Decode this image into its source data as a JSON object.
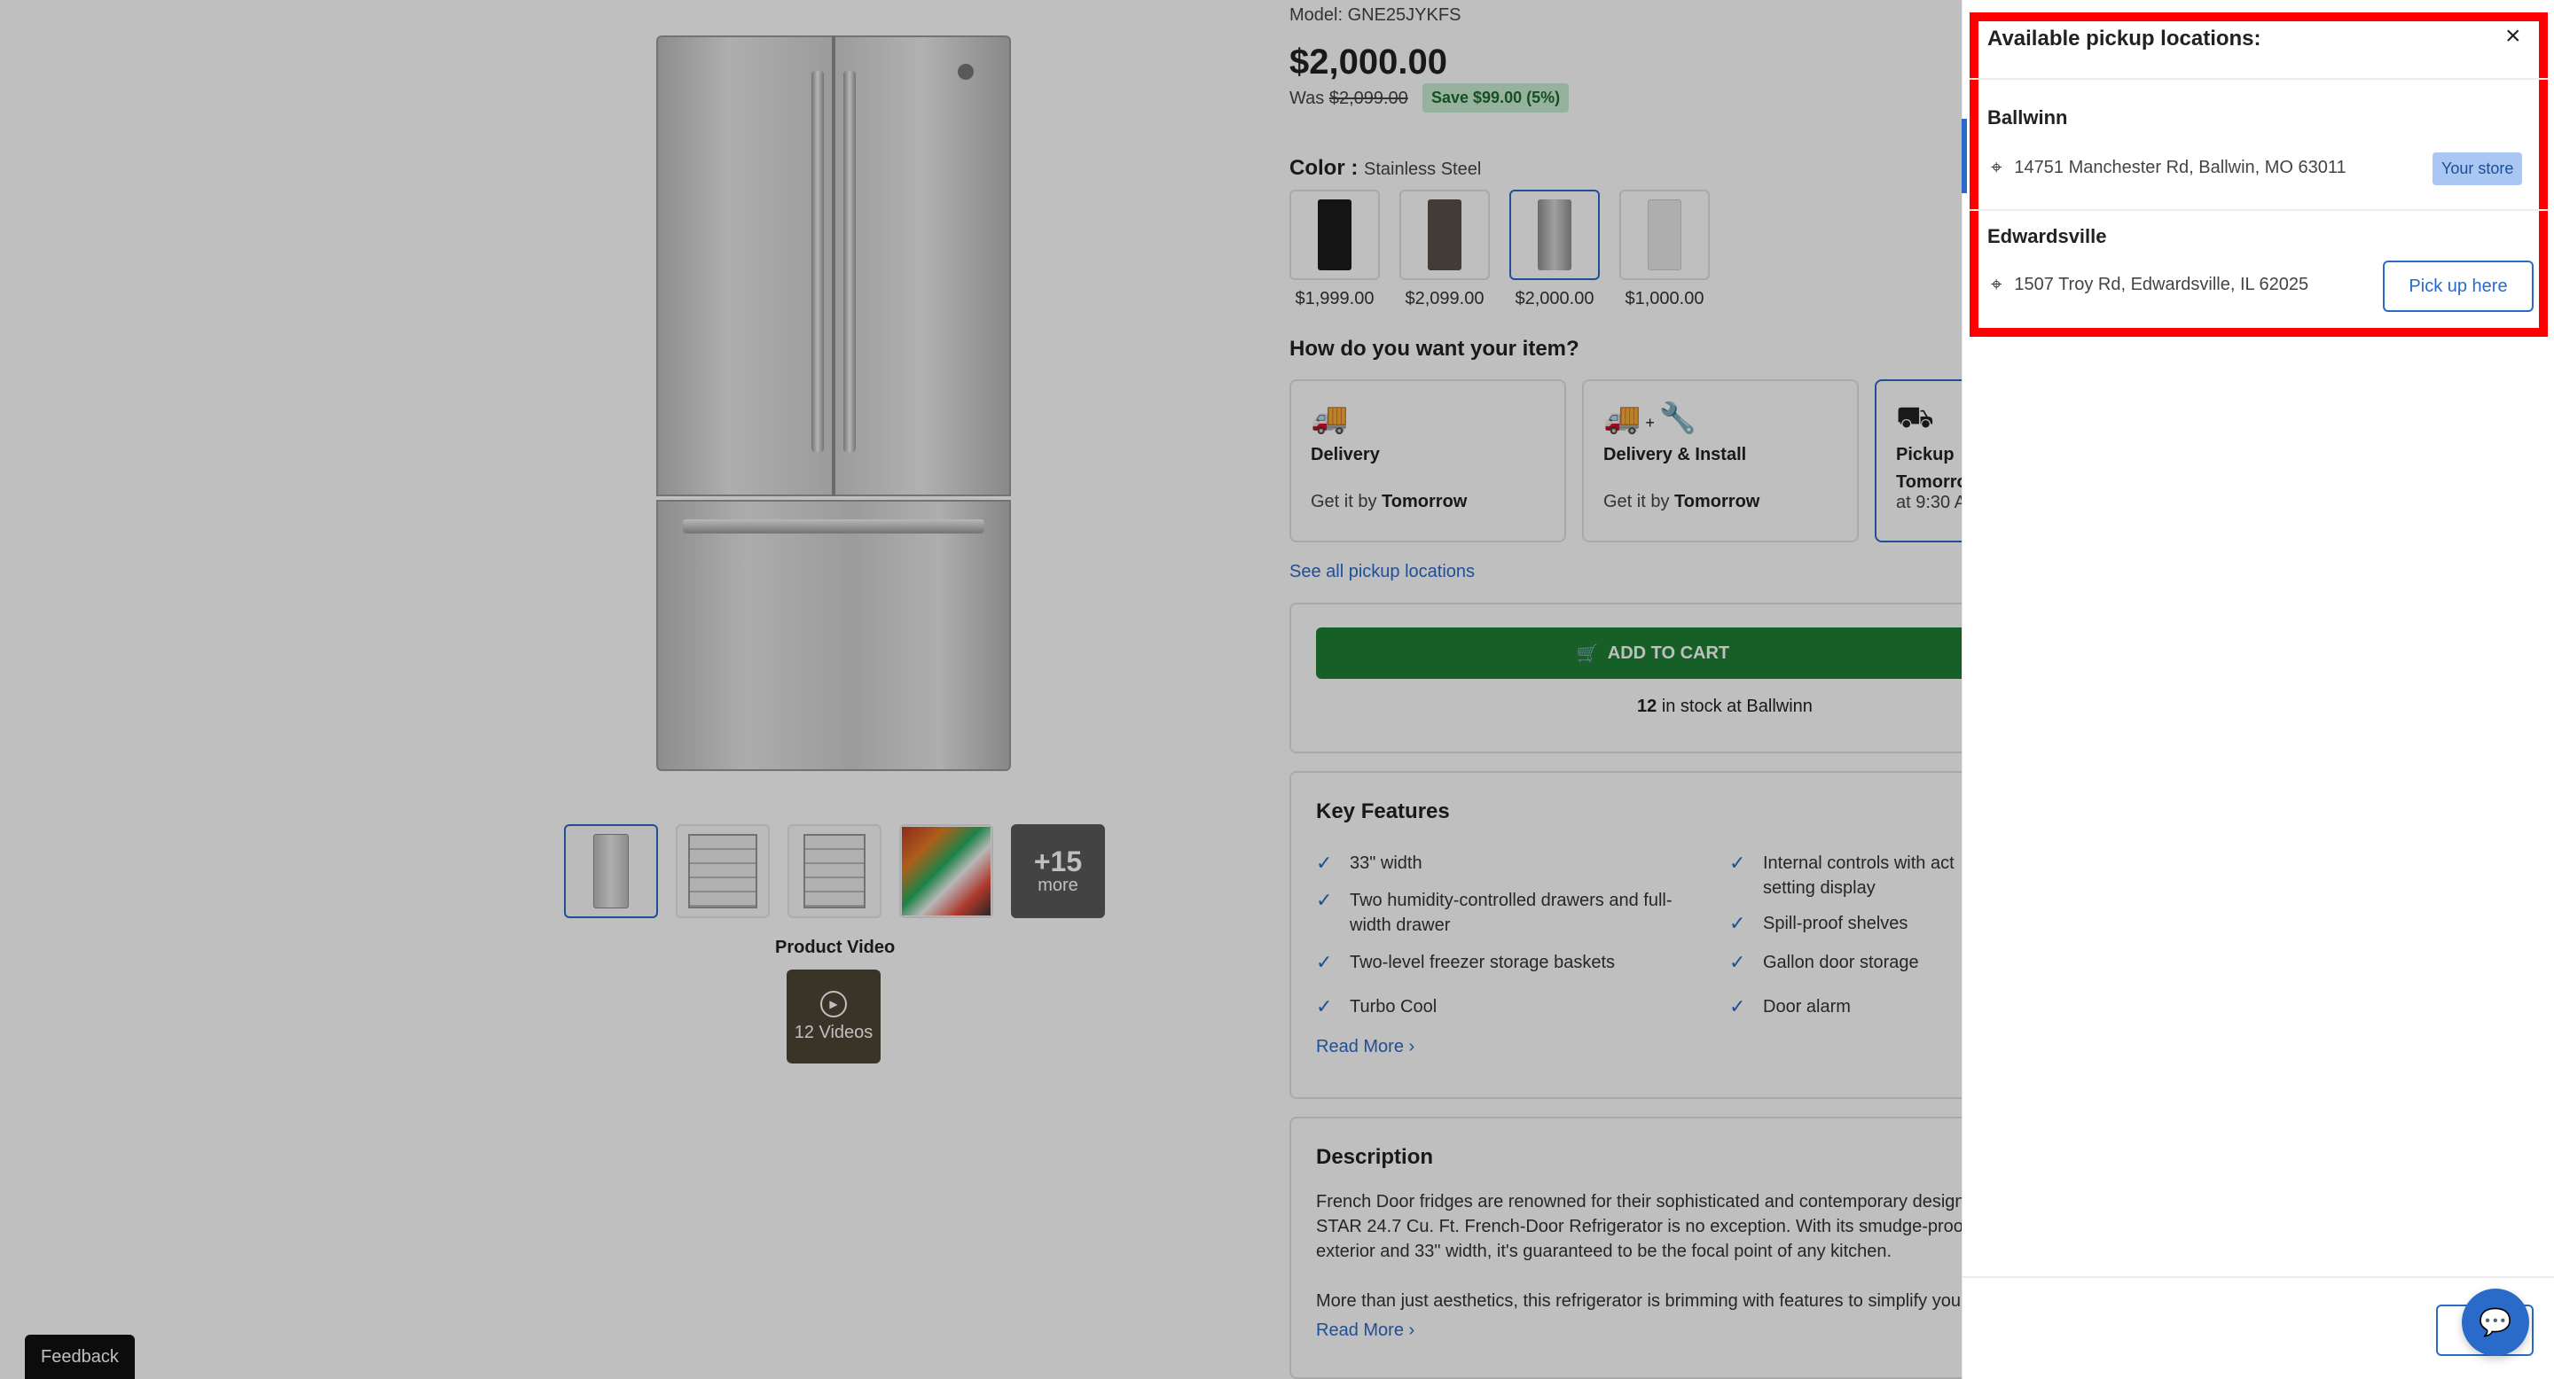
{
  "product": {
    "model": "Model: GNE25JYKFS",
    "price": "$2,000.00",
    "was_label": "Was",
    "was_price": "$2,099.00",
    "save_badge": "Save $99.00 (5%)",
    "color_label": "Color :",
    "color_value": "Stainless Steel",
    "swatches": [
      {
        "price": "$1,999.00",
        "color": "#1c1c1c"
      },
      {
        "price": "$2,099.00",
        "color": "#5a5148"
      },
      {
        "price": "$2,000.00",
        "color": "#a8a8a8"
      },
      {
        "price": "$1,000.00",
        "color": "#e8e8e8"
      }
    ]
  },
  "gallery": {
    "more_count": "+15",
    "more_label": "more",
    "video_label": "Product Video",
    "video_count": "12 Videos"
  },
  "fulfillment": {
    "question": "How do you want your item?",
    "options": [
      {
        "title": "Delivery",
        "prefix": "Get it by",
        "when": "Tomorrow",
        "icon": "truck-icon"
      },
      {
        "title": "Delivery & Install",
        "prefix": "Get it by",
        "when": "Tomorrow",
        "icon": "truck-wrench-icon"
      },
      {
        "title": "Pickup",
        "prefix": "Tomorro",
        "when": "at 9:30 A",
        "icon": "hand-truck-icon"
      }
    ],
    "see_all": "See all pickup locations"
  },
  "cart": {
    "add_label": "ADD TO CART",
    "stock_count": "12",
    "stock_text": "in stock at Ballwinn"
  },
  "features": {
    "title": "Key Features",
    "left": [
      "33\" width",
      "Two humidity-controlled drawers and full-",
      "width drawer",
      "Two-level freezer storage baskets",
      "Turbo Cool"
    ],
    "right": [
      "Internal controls with act",
      "setting display",
      "Spill-proof shelves",
      "Gallon door storage",
      "Door alarm"
    ],
    "read_more": "Read More"
  },
  "description": {
    "title": "Description",
    "lines": [
      "French Door fridges are renowned for their sophisticated and contemporary design",
      "STAR 24.7 Cu. Ft. French-Door Refrigerator is no exception. With its smudge-proof s",
      "exterior and 33\" width, it's guaranteed to be the focal point of any kitchen.",
      "More than just aesthetics, this refrigerator is brimming with features to simplify your l"
    ],
    "read_more": "Read More"
  },
  "feedback_label": "Feedback",
  "panel": {
    "title": "Available pickup locations:",
    "close": "×",
    "stores": [
      {
        "name": "Ballwinn",
        "address": "14751 Manchester Rd, Ballwin, MO 63011",
        "badge": "Your store"
      },
      {
        "name": "Edwardsville",
        "address": "1507 Troy Rd, Edwardsville, IL 62025",
        "button": "Pick up here"
      }
    ]
  },
  "colors": {
    "accent": "#2a6ac8",
    "cart_green": "#1e7f34",
    "highlight_red": "#ff0000"
  }
}
